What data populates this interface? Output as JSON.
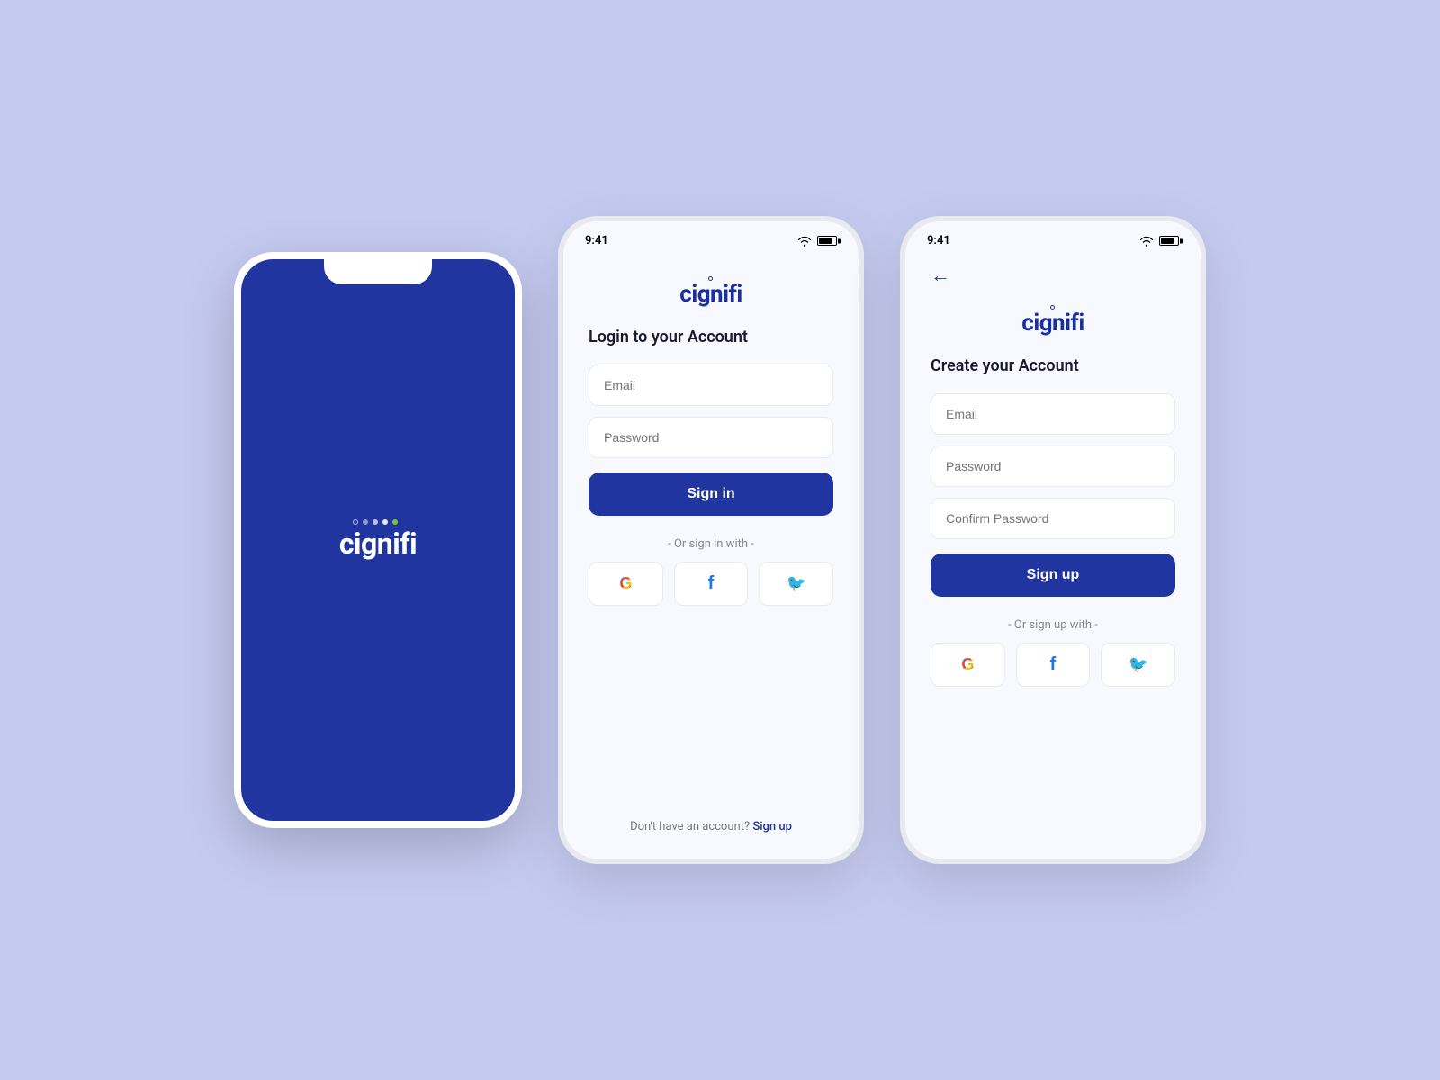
{
  "colors": {
    "bg": "#c5caf0",
    "brand": "#2035a0",
    "white": "#ffffff",
    "text_dark": "#1a1a2e",
    "text_gray": "#888888",
    "border": "#e8eaf0"
  },
  "splash": {
    "logo_text": "cignifi"
  },
  "phone2": {
    "status_time": "9:41",
    "logo_text": "cignifi",
    "title": "Login to your Account",
    "email_placeholder": "Email",
    "password_placeholder": "Password",
    "signin_label": "Sign in",
    "divider": "- Or sign in with -",
    "footer_text": "Don't have an account?",
    "footer_link": "Sign up"
  },
  "phone3": {
    "status_time": "9:41",
    "logo_text": "cignifi",
    "title": "Create your Account",
    "email_placeholder": "Email",
    "password_placeholder": "Password",
    "confirm_password_placeholder": "Confirm Password",
    "signup_label": "Sign up",
    "divider": "- Or sign up with -"
  }
}
